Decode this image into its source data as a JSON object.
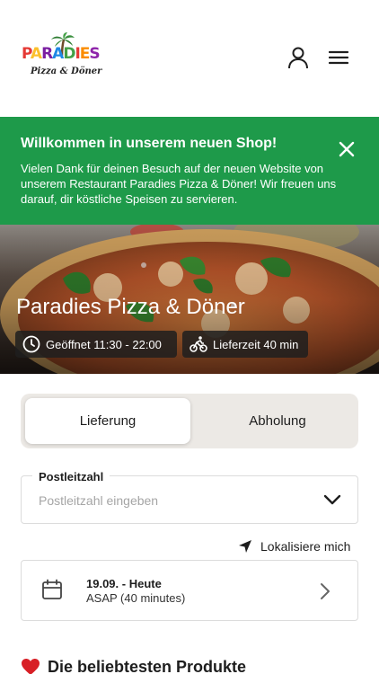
{
  "header": {
    "logo_text": "PARADIES",
    "logo_subtitle": "Pizza & Döner",
    "user_icon": "user-icon",
    "menu_icon": "hamburger-menu-icon"
  },
  "banner": {
    "title": "Willkommen in unserem neuen Shop!",
    "text": "Vielen Dank für deinen Besuch auf der neuen Website von unserem Restaurant Paradies Pizza & Döner! Wir freuen uns darauf, dir köstliche Speisen zu servieren.",
    "close_icon": "close-icon",
    "color": "#1e9a4a"
  },
  "hero": {
    "restaurant_name": "Paradies Pizza & Döner",
    "opening_hours": "Geöffnet 11:30 - 22:00",
    "delivery_time": "Lieferzeit 40 min"
  },
  "order_mode": {
    "options": [
      "Lieferung",
      "Abholung"
    ],
    "selected": "Lieferung"
  },
  "zip": {
    "label": "Postleitzahl",
    "placeholder": "Postleitzahl eingeben",
    "value": ""
  },
  "locate": {
    "label": "Lokalisiere mich"
  },
  "schedule": {
    "date": "19.09. - Heute",
    "time": "ASAP (40 minutes)"
  },
  "popular": {
    "title": "Die beliebtesten Produkte",
    "icon": "heart-icon"
  }
}
